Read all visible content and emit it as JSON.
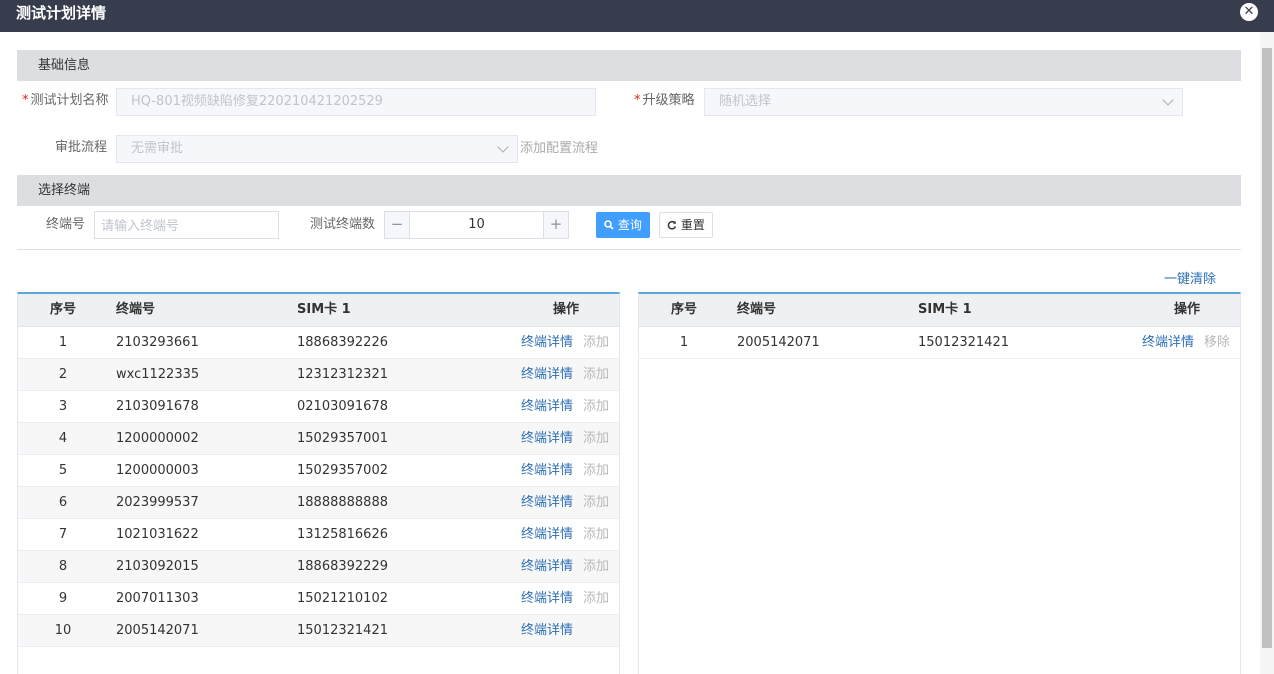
{
  "dialog": {
    "title": "测试计划详情",
    "close_glyph": "✕"
  },
  "basic": {
    "section_title": "基础信息",
    "plan_name_label": "测试计划名称",
    "plan_name_value": "HQ-801视频缺陷修复220210421202529",
    "strategy_label": "升级策略",
    "strategy_value": "随机选择",
    "approval_label": "审批流程",
    "approval_value": "无需审批",
    "add_flow_link": "添加配置流程",
    "required_mark": "*"
  },
  "select": {
    "section_title": "选择终端",
    "terminal_label": "终端号",
    "terminal_placeholder": "请输入终端号",
    "count_label": "测试终端数",
    "count_value": "10",
    "minus": "−",
    "plus": "+",
    "search_btn": "查询",
    "reset_btn": "重置",
    "clear_all": "一键清除"
  },
  "left_table": {
    "headers": {
      "idx": "序号",
      "terminal": "终端号",
      "sim": "SIM卡 1",
      "op": "操作"
    },
    "detail_label": "终端详情",
    "add_label": "添加",
    "rows": [
      {
        "idx": "1",
        "terminal": "2103293661",
        "sim": "18868392226"
      },
      {
        "idx": "2",
        "terminal": "wxc1122335",
        "sim": "12312312321"
      },
      {
        "idx": "3",
        "terminal": "2103091678",
        "sim": "02103091678"
      },
      {
        "idx": "4",
        "terminal": "1200000002",
        "sim": "15029357001"
      },
      {
        "idx": "5",
        "terminal": "1200000003",
        "sim": "15029357002"
      },
      {
        "idx": "6",
        "terminal": "2023999537",
        "sim": "18888888888"
      },
      {
        "idx": "7",
        "terminal": "1021031622",
        "sim": "13125816626"
      },
      {
        "idx": "8",
        "terminal": "2103092015",
        "sim": "18868392229"
      },
      {
        "idx": "9",
        "terminal": "2007011303",
        "sim": "15021210102"
      },
      {
        "idx": "10",
        "terminal": "2005142071",
        "sim": "15012321421"
      }
    ]
  },
  "right_table": {
    "headers": {
      "idx": "序号",
      "terminal": "终端号",
      "sim": "SIM卡 1",
      "op": "操作"
    },
    "detail_label": "终端详情",
    "remove_label": "移除",
    "rows": [
      {
        "idx": "1",
        "terminal": "2005142071",
        "sim": "15012321421"
      }
    ]
  }
}
